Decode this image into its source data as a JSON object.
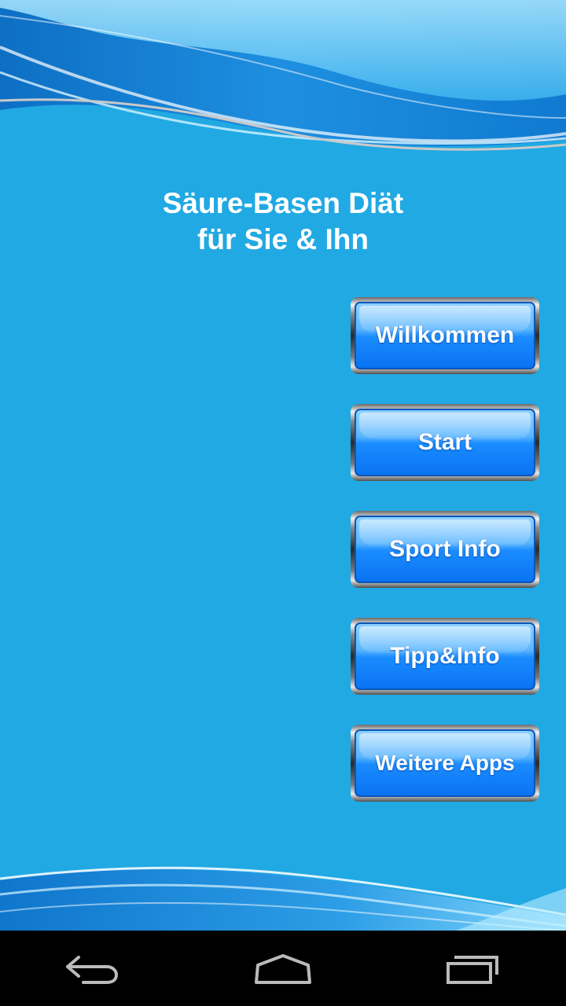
{
  "app": {
    "title_line1": "Säure-Basen Diät",
    "title_line2": "für Sie & Ihn"
  },
  "menu": {
    "buttons": [
      {
        "label": "Willkommen"
      },
      {
        "label": "Start"
      },
      {
        "label": "Sport Info"
      },
      {
        "label": "Tipp&Info"
      },
      {
        "label": "Weitere Apps"
      }
    ]
  },
  "navbar": {
    "icons": [
      "back-icon",
      "home-icon",
      "recent-apps-icon"
    ]
  },
  "colors": {
    "background": "#21a9e3",
    "button_blue": "#0a73f2",
    "text": "#ffffff",
    "navbar": "#000000"
  }
}
